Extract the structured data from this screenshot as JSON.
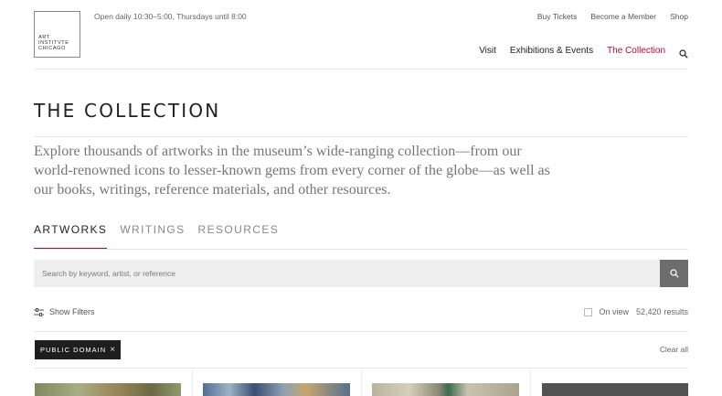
{
  "logo": {
    "lines": [
      "ART",
      "INSTITVTE",
      "CHICAGO"
    ]
  },
  "header": {
    "hours": "Open daily 10:30–5:00, Thursdays until 8:00",
    "util_nav": [
      "Buy Tickets",
      "Become a Member",
      "Shop"
    ],
    "main_nav": [
      {
        "label": "Visit",
        "active": false
      },
      {
        "label": "Exhibitions & Events",
        "active": false
      },
      {
        "label": "The Collection",
        "active": true
      }
    ],
    "search_icon": "search-icon"
  },
  "page": {
    "title": "THE COLLECTION",
    "intro": "Explore thousands of artworks in the museum’s wide-ranging collection—from our world-renowned icons to lesser-known gems from every corner of the globe—as well as our books, writings, reference materials, and other resources."
  },
  "tabs": [
    {
      "label": "ARTWORKS",
      "active": true
    },
    {
      "label": "WRITINGS",
      "active": false
    },
    {
      "label": "RESOURCES",
      "active": false
    }
  ],
  "search": {
    "placeholder": "Search by keyword, artist, or reference",
    "value": ""
  },
  "filters": {
    "show_filters_label": "Show Filters",
    "on_view_label": "On view",
    "on_view_checked": false,
    "results_count": "52,420",
    "results_label": "results"
  },
  "active_tags": [
    {
      "label": "PUBLIC DOMAIN",
      "remove_icon": "close-icon"
    }
  ],
  "clear_all_label": "Clear all",
  "colors": {
    "accent": "#b50938",
    "chip_bg": "#1e1e1e",
    "search_bg": "#efefef",
    "search_button": "#6d6d6d"
  }
}
